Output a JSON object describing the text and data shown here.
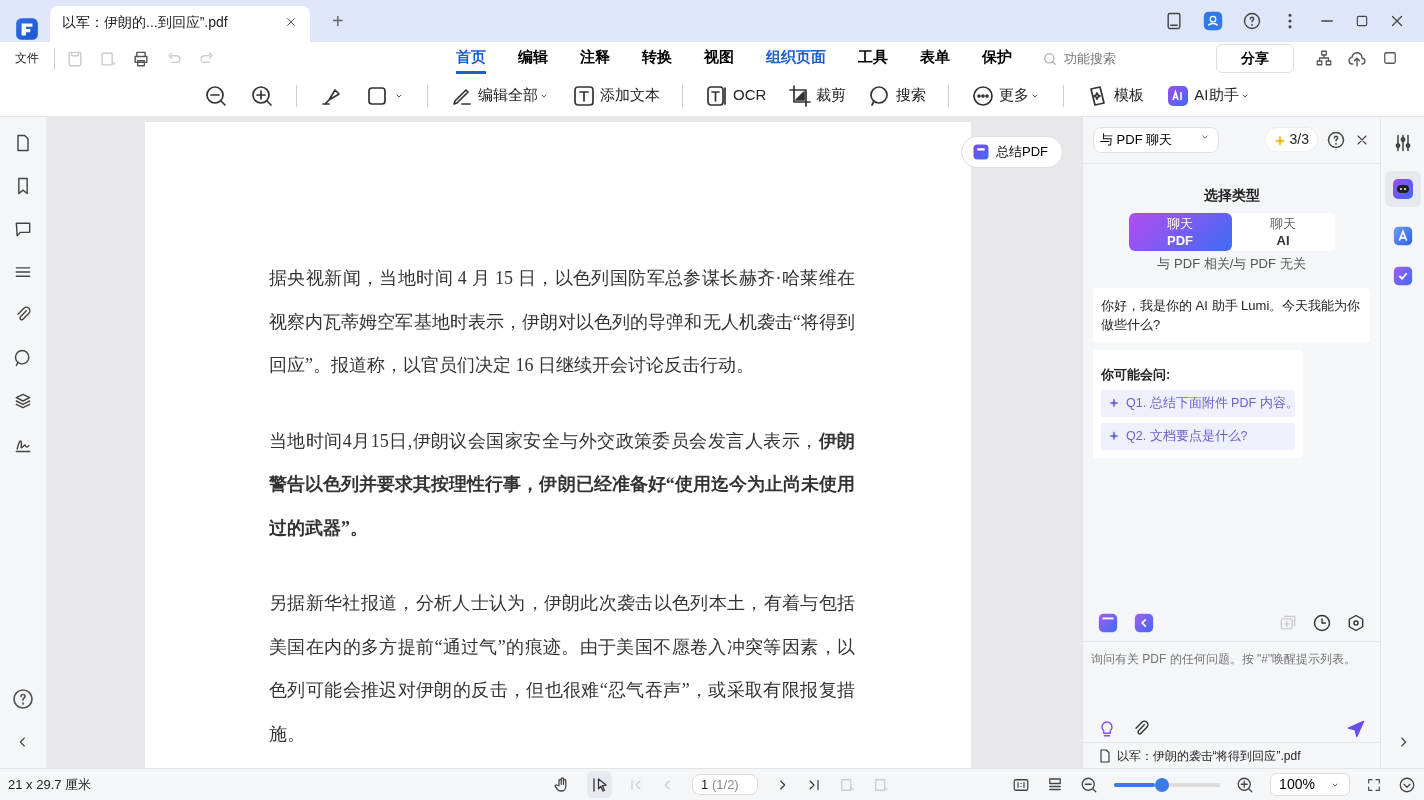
{
  "tab_bar": {
    "tabs": [
      {
        "title": "以军：伊朗的...到回应”.pdf",
        "selected": true
      }
    ],
    "new_tab": "+"
  },
  "menu": {
    "file": "文件",
    "tabs": [
      {
        "label": "首页",
        "selected": true
      },
      {
        "label": "编辑",
        "selected": false
      },
      {
        "label": "注释",
        "selected": false
      },
      {
        "label": "转换",
        "selected": false
      },
      {
        "label": "视图",
        "selected": false
      },
      {
        "label": "组织页面",
        "selected": false,
        "highlight": true
      },
      {
        "label": "工具",
        "selected": false
      },
      {
        "label": "表单",
        "selected": false
      },
      {
        "label": "保护",
        "selected": false
      }
    ],
    "search_placeholder": "功能搜索",
    "share": "分享"
  },
  "toolbar": [
    {
      "label": "编辑全部",
      "dropdown": true
    },
    {
      "label": "添加文本",
      "dropdown": false
    },
    {
      "label": "OCR",
      "dropdown": false
    },
    {
      "label": "裁剪",
      "dropdown": false
    },
    {
      "label": "搜索",
      "dropdown": false
    },
    {
      "label": "更多",
      "dropdown": true
    },
    {
      "label": "模板",
      "dropdown": false
    },
    {
      "label": "AI助手",
      "dropdown": true
    }
  ],
  "document": {
    "summarize_button": "总结PDF",
    "paragraphs": [
      "据央视新闻，当地时间 4 月 15 日，以色列国防军总参谋长赫齐·哈莱维在视察内瓦蒂姆空军基地时表示，伊朗对以色列的导弹和无人机袭击“将得到回应”。报道称，以官员们决定 16 日继续开会讨论反击行动。",
      "当地时间4月15日,伊朗议会国家安全与外交政策委员会发言人表示，**伊朗警告以色列并要求其按理性行事，伊朗已经准备好“使用迄今为止尚未使用过的武器”。**",
      "另据新华社报道，分析人士认为，伊朗此次袭击以色列本土，有着与包括美国在内的多方提前“通过气”的痕迹。由于美国不愿卷入冲突等因素，以色列可能会推迟对伊朗的反击，但也很难“忍气吞声”，或采取有限报复措施。"
    ]
  },
  "ai_panel": {
    "mode": "与 PDF 聊天",
    "credits": "3/3",
    "heading": "选择类型",
    "segments": [
      {
        "line1": "聊天",
        "line2": "PDF",
        "selected": true
      },
      {
        "line1": "聊天",
        "line2": "AI",
        "selected": false
      }
    ],
    "segment_hint": "与 PDF 相关/与 PDF 无关",
    "greeting": "你好，我是你的 AI 助手 Lumi。今天我能为你做些什么?",
    "suggestions_title": "你可能会问:",
    "suggestions": [
      "Q1. 总结下面附件 PDF 内容。",
      "Q2. 文档要点是什么?"
    ],
    "input_placeholder": "询问有关 PDF 的任何问题。按 \"#\"唤醒提示列表。",
    "attachment": "以军：伊朗的袭击“将得到回应”.pdf"
  },
  "status_bar": {
    "page_size": "21 x 29.7 厘米",
    "page": "1",
    "page_total": "(1/2)",
    "zoom_slider": {
      "level": 0.39
    },
    "zoom": "100%"
  }
}
